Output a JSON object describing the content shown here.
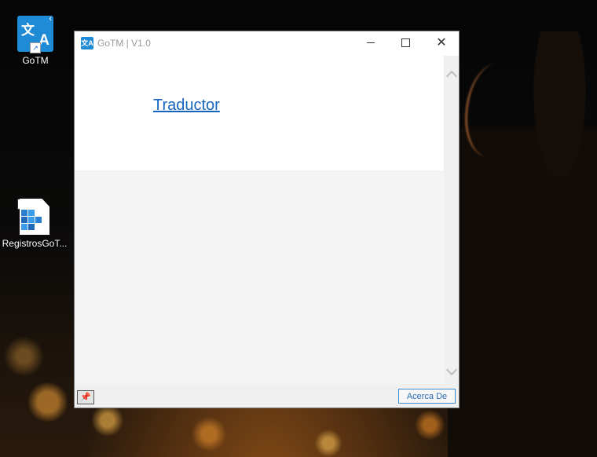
{
  "desktop": {
    "icons": [
      {
        "label": "GoTM",
        "icon": "translate-app-icon"
      },
      {
        "label": "RegistrosGoT...",
        "icon": "registry-file-icon"
      }
    ]
  },
  "window": {
    "title": "GoTM | V1.0",
    "icon": "translate-app-icon",
    "controls": {
      "minimize": "minimize-icon",
      "maximize": "maximize-icon",
      "close": "close-icon"
    }
  },
  "content": {
    "link_label": "Traductor"
  },
  "footer": {
    "pin_icon": "pin-icon",
    "about_label": "Acerca De"
  },
  "colors": {
    "accent": "#1f8ad6",
    "link": "#1565c0"
  }
}
